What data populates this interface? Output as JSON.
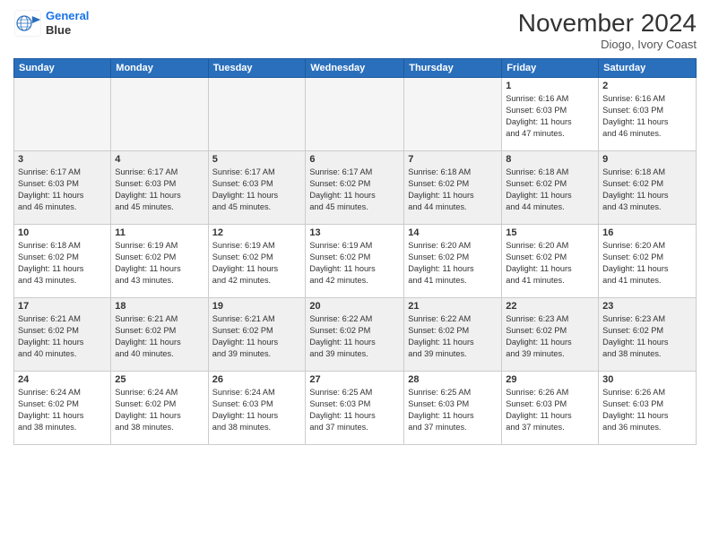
{
  "header": {
    "logo_line1": "General",
    "logo_line2": "Blue",
    "month": "November 2024",
    "location": "Diogo, Ivory Coast"
  },
  "weekdays": [
    "Sunday",
    "Monday",
    "Tuesday",
    "Wednesday",
    "Thursday",
    "Friday",
    "Saturday"
  ],
  "weeks": [
    [
      {
        "day": "",
        "info": ""
      },
      {
        "day": "",
        "info": ""
      },
      {
        "day": "",
        "info": ""
      },
      {
        "day": "",
        "info": ""
      },
      {
        "day": "",
        "info": ""
      },
      {
        "day": "1",
        "info": "Sunrise: 6:16 AM\nSunset: 6:03 PM\nDaylight: 11 hours\nand 47 minutes."
      },
      {
        "day": "2",
        "info": "Sunrise: 6:16 AM\nSunset: 6:03 PM\nDaylight: 11 hours\nand 46 minutes."
      }
    ],
    [
      {
        "day": "3",
        "info": "Sunrise: 6:17 AM\nSunset: 6:03 PM\nDaylight: 11 hours\nand 46 minutes."
      },
      {
        "day": "4",
        "info": "Sunrise: 6:17 AM\nSunset: 6:03 PM\nDaylight: 11 hours\nand 45 minutes."
      },
      {
        "day": "5",
        "info": "Sunrise: 6:17 AM\nSunset: 6:03 PM\nDaylight: 11 hours\nand 45 minutes."
      },
      {
        "day": "6",
        "info": "Sunrise: 6:17 AM\nSunset: 6:02 PM\nDaylight: 11 hours\nand 45 minutes."
      },
      {
        "day": "7",
        "info": "Sunrise: 6:18 AM\nSunset: 6:02 PM\nDaylight: 11 hours\nand 44 minutes."
      },
      {
        "day": "8",
        "info": "Sunrise: 6:18 AM\nSunset: 6:02 PM\nDaylight: 11 hours\nand 44 minutes."
      },
      {
        "day": "9",
        "info": "Sunrise: 6:18 AM\nSunset: 6:02 PM\nDaylight: 11 hours\nand 43 minutes."
      }
    ],
    [
      {
        "day": "10",
        "info": "Sunrise: 6:18 AM\nSunset: 6:02 PM\nDaylight: 11 hours\nand 43 minutes."
      },
      {
        "day": "11",
        "info": "Sunrise: 6:19 AM\nSunset: 6:02 PM\nDaylight: 11 hours\nand 43 minutes."
      },
      {
        "day": "12",
        "info": "Sunrise: 6:19 AM\nSunset: 6:02 PM\nDaylight: 11 hours\nand 42 minutes."
      },
      {
        "day": "13",
        "info": "Sunrise: 6:19 AM\nSunset: 6:02 PM\nDaylight: 11 hours\nand 42 minutes."
      },
      {
        "day": "14",
        "info": "Sunrise: 6:20 AM\nSunset: 6:02 PM\nDaylight: 11 hours\nand 41 minutes."
      },
      {
        "day": "15",
        "info": "Sunrise: 6:20 AM\nSunset: 6:02 PM\nDaylight: 11 hours\nand 41 minutes."
      },
      {
        "day": "16",
        "info": "Sunrise: 6:20 AM\nSunset: 6:02 PM\nDaylight: 11 hours\nand 41 minutes."
      }
    ],
    [
      {
        "day": "17",
        "info": "Sunrise: 6:21 AM\nSunset: 6:02 PM\nDaylight: 11 hours\nand 40 minutes."
      },
      {
        "day": "18",
        "info": "Sunrise: 6:21 AM\nSunset: 6:02 PM\nDaylight: 11 hours\nand 40 minutes."
      },
      {
        "day": "19",
        "info": "Sunrise: 6:21 AM\nSunset: 6:02 PM\nDaylight: 11 hours\nand 39 minutes."
      },
      {
        "day": "20",
        "info": "Sunrise: 6:22 AM\nSunset: 6:02 PM\nDaylight: 11 hours\nand 39 minutes."
      },
      {
        "day": "21",
        "info": "Sunrise: 6:22 AM\nSunset: 6:02 PM\nDaylight: 11 hours\nand 39 minutes."
      },
      {
        "day": "22",
        "info": "Sunrise: 6:23 AM\nSunset: 6:02 PM\nDaylight: 11 hours\nand 39 minutes."
      },
      {
        "day": "23",
        "info": "Sunrise: 6:23 AM\nSunset: 6:02 PM\nDaylight: 11 hours\nand 38 minutes."
      }
    ],
    [
      {
        "day": "24",
        "info": "Sunrise: 6:24 AM\nSunset: 6:02 PM\nDaylight: 11 hours\nand 38 minutes."
      },
      {
        "day": "25",
        "info": "Sunrise: 6:24 AM\nSunset: 6:02 PM\nDaylight: 11 hours\nand 38 minutes."
      },
      {
        "day": "26",
        "info": "Sunrise: 6:24 AM\nSunset: 6:03 PM\nDaylight: 11 hours\nand 38 minutes."
      },
      {
        "day": "27",
        "info": "Sunrise: 6:25 AM\nSunset: 6:03 PM\nDaylight: 11 hours\nand 37 minutes."
      },
      {
        "day": "28",
        "info": "Sunrise: 6:25 AM\nSunset: 6:03 PM\nDaylight: 11 hours\nand 37 minutes."
      },
      {
        "day": "29",
        "info": "Sunrise: 6:26 AM\nSunset: 6:03 PM\nDaylight: 11 hours\nand 37 minutes."
      },
      {
        "day": "30",
        "info": "Sunrise: 6:26 AM\nSunset: 6:03 PM\nDaylight: 11 hours\nand 36 minutes."
      }
    ]
  ]
}
